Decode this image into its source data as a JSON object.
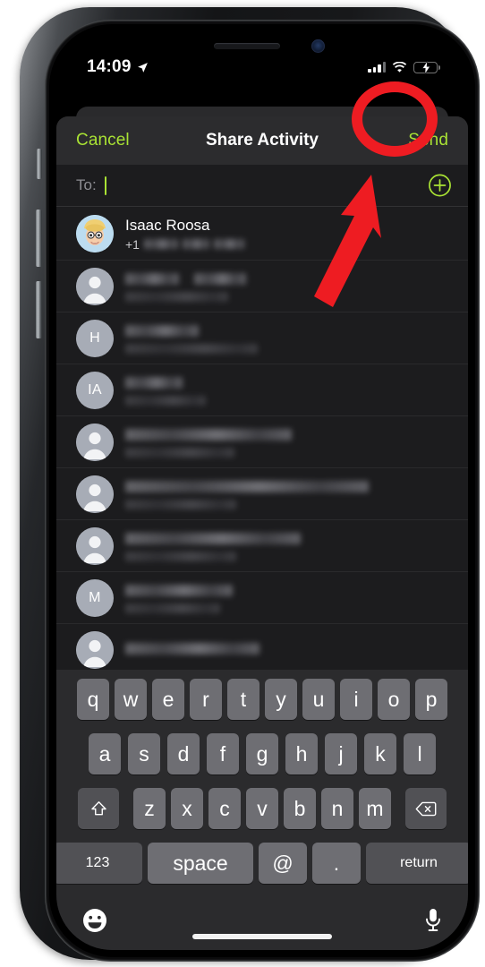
{
  "status_bar": {
    "time": "14:09",
    "location_icon": "location-arrow-icon",
    "signal_icon": "cellular-signal-icon",
    "wifi_icon": "wifi-icon",
    "battery_icon": "battery-charging-icon"
  },
  "navbar": {
    "cancel_label": "Cancel",
    "title": "Share Activity",
    "send_label": "Send"
  },
  "recipient_field": {
    "to_label": "To:",
    "value": "",
    "add_contact_icon": "plus-circle-icon"
  },
  "contacts": [
    {
      "name": "Isaac Roosa",
      "avatar_type": "memoji",
      "initials": "",
      "prefix": "+1",
      "number_redacted": true,
      "detail_redacted": false
    },
    {
      "name": "",
      "avatar_type": "person",
      "initials": "",
      "prefix": "",
      "number_redacted": true,
      "detail_redacted": true
    },
    {
      "name": "",
      "avatar_type": "initials",
      "initials": "H",
      "prefix": "",
      "number_redacted": true,
      "detail_redacted": true
    },
    {
      "name": "",
      "avatar_type": "initials",
      "initials": "IA",
      "prefix": "",
      "number_redacted": true,
      "detail_redacted": true
    },
    {
      "name": "",
      "avatar_type": "person",
      "initials": "",
      "prefix": "",
      "number_redacted": true,
      "detail_redacted": true
    },
    {
      "name": "",
      "avatar_type": "person",
      "initials": "",
      "prefix": "",
      "number_redacted": true,
      "detail_redacted": true
    },
    {
      "name": "",
      "avatar_type": "person",
      "initials": "",
      "prefix": "",
      "number_redacted": true,
      "detail_redacted": true
    },
    {
      "name": "",
      "avatar_type": "initials",
      "initials": "M",
      "prefix": "",
      "number_redacted": true,
      "detail_redacted": true
    }
  ],
  "keyboard": {
    "row1": [
      "q",
      "w",
      "e",
      "r",
      "t",
      "y",
      "u",
      "i",
      "o",
      "p"
    ],
    "row2": [
      "a",
      "s",
      "d",
      "f",
      "g",
      "h",
      "j",
      "k",
      "l"
    ],
    "row3": [
      "z",
      "x",
      "c",
      "v",
      "b",
      "n",
      "m"
    ],
    "shift_icon": "shift-arrow-icon",
    "delete_icon": "backspace-delete-icon",
    "numbers_label": "123",
    "space_label": "space",
    "at_label": "@",
    "period_label": ".",
    "return_label": "return",
    "emoji_icon": "emoji-smiley-icon",
    "dictation_icon": "microphone-icon"
  },
  "annotation": {
    "highlight_target": "Send",
    "shape": "ellipse-and-arrow",
    "color": "#ee1c22"
  },
  "colors": {
    "accent_green": "#a9e234",
    "sheet_background": "#1c1c1e",
    "navbar_background": "#2c2c2e",
    "keyboard_background": "#2b2b2d",
    "key_background": "#6e6e73",
    "function_key_background": "#515155",
    "annotation_red": "#ee1c22",
    "battery_green": "#30d158"
  }
}
